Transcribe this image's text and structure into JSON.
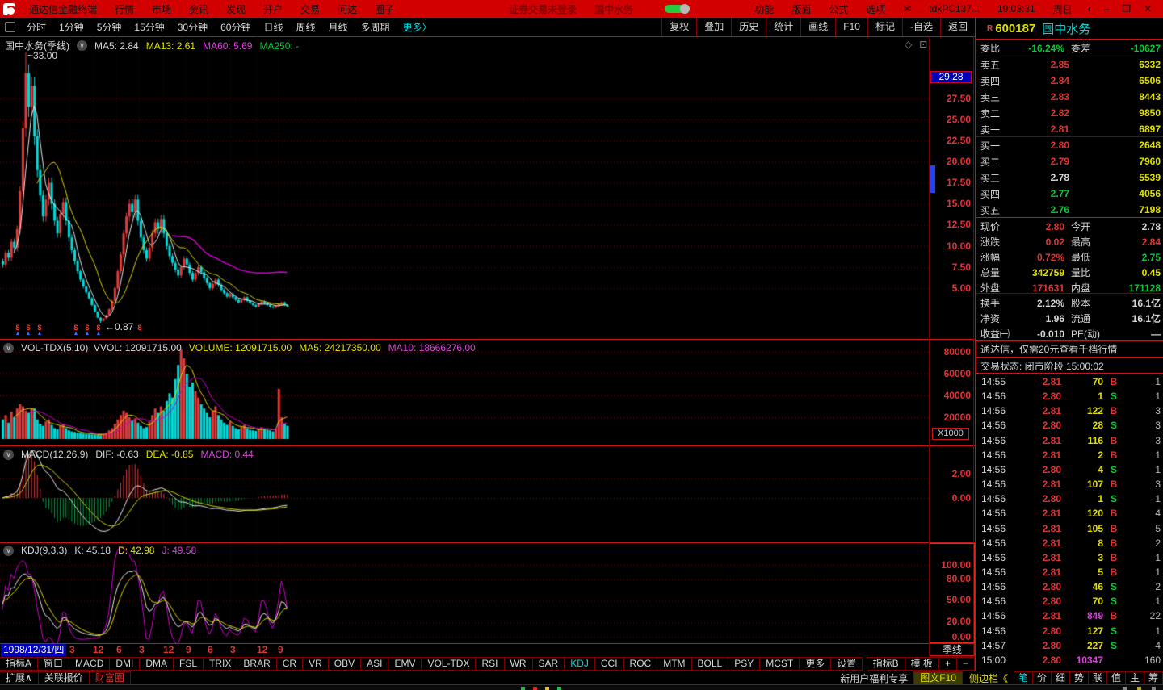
{
  "colors": {
    "red": "#e03333",
    "yellow": "#e0e000",
    "cyan": "#00d8d8",
    "green": "#00cc33",
    "magenta": "#d844d8",
    "white": "#d8d8d8",
    "blue": "#0000bb",
    "titlebar_red": "#d20000",
    "up_candle": "#e23b3b",
    "down_candle": "#00dcdc"
  },
  "titlebar": {
    "app_name": "通达信金融终端",
    "menus": [
      "行情",
      "市场",
      "资讯",
      "发现",
      "开户",
      "交易",
      "问达",
      "圈子"
    ],
    "login_status": "证券交易未登录",
    "current_stock": "国中水务",
    "right_menus": [
      "功能",
      "版面",
      "公式",
      "选项"
    ],
    "mail_icon": "✉",
    "host": "tdxPC137...",
    "clock": "19:03:31",
    "weekday": "周日",
    "window_controls": [
      "‹",
      "–",
      "❐",
      "✕"
    ]
  },
  "toolbar": {
    "periods": [
      "分时",
      "1分钟",
      "5分钟",
      "15分钟",
      "30分钟",
      "60分钟",
      "日线",
      "周线",
      "月线",
      "多周期"
    ],
    "more": "更多〉",
    "buttons": [
      "复权",
      "叠加",
      "历史",
      "统计",
      "画线",
      "F10",
      "标记",
      "-自选",
      "返回"
    ]
  },
  "chart": {
    "header": {
      "title": "国中水务(季线)",
      "ma5": "MA5: 2.84",
      "ma13": "MA13: 2.61",
      "ma60": "MA60: 5.69",
      "ma250": "MA250: -"
    },
    "corner_icons": [
      "◇",
      "⊡"
    ],
    "price_axis_labels": [
      "27.50",
      "25.00",
      "22.50",
      "20.00",
      "17.50",
      "15.00",
      "12.50",
      "10.00",
      "7.50",
      "5.00"
    ],
    "price_tag": "29.28",
    "peak_label": "~33.00",
    "trough_label": "←0.87",
    "vol_header": {
      "name": "VOL-TDX(5,10)",
      "vvol": "VVOL: 12091715.00",
      "volume": "VOLUME: 12091715.00",
      "ma5": "MA5: 24217350.00",
      "ma10": "MA10: 18666276.00"
    },
    "vol_axis_labels": [
      "80000",
      "60000",
      "40000",
      "20000"
    ],
    "vol_unit": "X1000",
    "macd_header": {
      "name": "MACD(12,26,9)",
      "dif": "DIF: -0.63",
      "dea": "DEA: -0.85",
      "macd": "MACD: 0.44"
    },
    "macd_axis_labels": [
      "2.00",
      "0.00"
    ],
    "kdj_header": {
      "name": "KDJ(9,3,3)",
      "k": "K: 45.18",
      "d": "D: 42.98",
      "j": "J: 49.58"
    },
    "kdj_axis_labels": [
      "100.00",
      "80.00",
      "50.00",
      "20.00",
      "0.00"
    ],
    "date_start": "1998/12/31/四",
    "date_ticks": [
      "3",
      "12",
      "6",
      "3",
      "12",
      "9",
      "6",
      "3",
      "12",
      "9"
    ],
    "period_label": "季线"
  },
  "chart_data": {
    "type": "candlestick",
    "closes": [
      7.8,
      9.2,
      8.6,
      10.5,
      9.8,
      12.0,
      16.5,
      24.0,
      30.5,
      26.5,
      29.0,
      23.0,
      19.0,
      16.0,
      13.5,
      15.5,
      17.5,
      15.0,
      13.0,
      11.5,
      13.8,
      15.2,
      13.0,
      11.0,
      9.5,
      8.2,
      7.0,
      6.0,
      5.2,
      4.5,
      3.8,
      3.0,
      2.2,
      1.5,
      1.1,
      1.4,
      1.8,
      2.5,
      3.5,
      5.0,
      7.0,
      9.0,
      11.5,
      13.5,
      15.0,
      14.0,
      15.5,
      13.0,
      11.0,
      9.5,
      8.5,
      9.8,
      11.5,
      12.8,
      12.0,
      13.2,
      11.5,
      10.0,
      8.8,
      8.0,
      7.2,
      6.5,
      7.5,
      8.5,
      7.8,
      6.8,
      6.0,
      6.8,
      7.5,
      6.9,
      6.2,
      5.6,
      5.0,
      5.5,
      6.0,
      5.4,
      4.8,
      4.4,
      4.0,
      4.3,
      3.9,
      3.6,
      3.3,
      3.6,
      3.9,
      3.5,
      3.2,
      3.0,
      2.8,
      3.1,
      3.4,
      3.2,
      3.0,
      2.8,
      2.7,
      2.9,
      3.1,
      3.3,
      3.0,
      2.8
    ],
    "volumes": [
      18000,
      22000,
      15000,
      25000,
      20000,
      28000,
      32000,
      30000,
      26000,
      24000,
      28000,
      28000,
      18000,
      14000,
      12000,
      16000,
      18000,
      13000,
      10000,
      9000,
      12000,
      14000,
      10000,
      8000,
      7000,
      6500,
      6000,
      5500,
      5000,
      4800,
      4500,
      4200,
      4000,
      3800,
      3500,
      5000,
      6000,
      8000,
      10000,
      14000,
      18000,
      22000,
      26000,
      24000,
      20000,
      17000,
      19000,
      15000,
      12000,
      10000,
      11000,
      16000,
      22000,
      28000,
      24000,
      30000,
      26000,
      35000,
      42000,
      38000,
      55000,
      68000,
      82000,
      74000,
      60000,
      48000,
      52000,
      44000,
      38000,
      32000,
      28000,
      24000,
      20000,
      26000,
      30000,
      22000,
      18000,
      15000,
      13000,
      16000,
      12000,
      10000,
      9000,
      11000,
      13000,
      10000,
      8500,
      8000,
      7500,
      9000,
      11000,
      9500,
      8500,
      8000,
      7000,
      9000,
      46000,
      20000,
      14000,
      12092
    ],
    "peak": {
      "index": 8,
      "high": 33.0
    },
    "trough": {
      "index": 34,
      "low": 0.87
    },
    "price_axis": {
      "min": 5.0,
      "max": 27.5,
      "step": 2.5
    },
    "volume_axis": {
      "max": 80000,
      "unit": "X1000"
    },
    "kdj_axis": [
      100,
      80,
      50,
      20,
      0
    ],
    "macd_axis": [
      2.0,
      0.0
    ]
  },
  "quote": {
    "flag": "R",
    "code": "600187",
    "name": "国中水务",
    "weibi_label": "委比",
    "weibi": "-16.24%",
    "weicha_label": "委差",
    "weicha": "-10627",
    "asks": [
      [
        "卖五",
        "2.85",
        "6332",
        "r"
      ],
      [
        "卖四",
        "2.84",
        "6506",
        "r"
      ],
      [
        "卖三",
        "2.83",
        "8443",
        "r"
      ],
      [
        "卖二",
        "2.82",
        "9850",
        "r"
      ],
      [
        "卖一",
        "2.81",
        "6897",
        "r"
      ]
    ],
    "bids": [
      [
        "买一",
        "2.80",
        "2648",
        "r"
      ],
      [
        "买二",
        "2.79",
        "7960",
        "r"
      ],
      [
        "买三",
        "2.78",
        "5539",
        "w"
      ],
      [
        "买四",
        "2.77",
        "4056",
        "g"
      ],
      [
        "买五",
        "2.76",
        "7198",
        "g"
      ]
    ],
    "stats": [
      [
        "现价",
        "2.80",
        "r",
        "今开",
        "2.78",
        "w"
      ],
      [
        "涨跌",
        "0.02",
        "r",
        "最高",
        "2.84",
        "r"
      ],
      [
        "涨幅",
        "0.72%",
        "r",
        "最低",
        "2.75",
        "g"
      ],
      [
        "总量",
        "342759",
        "y",
        "量比",
        "0.45",
        "y"
      ],
      [
        "外盘",
        "171631",
        "r",
        "内盘",
        "171128",
        "g"
      ],
      [
        "换手",
        "2.12%",
        "w",
        "股本",
        "16.1亿",
        "w"
      ],
      [
        "净资",
        "1.96",
        "w",
        "流通",
        "16.1亿",
        "w"
      ],
      [
        "收益㈠",
        "-0.010",
        "w",
        "PE(动)",
        "—",
        "w"
      ]
    ],
    "banner": "通达信，仅需20元查看千档行情",
    "session": "交易状态: 闭市阶段 15:00:02",
    "ticks": [
      [
        "14:55",
        "2.81",
        "70",
        "B",
        "1",
        "y"
      ],
      [
        "14:56",
        "2.80",
        "1",
        "S",
        "1",
        "y"
      ],
      [
        "14:56",
        "2.81",
        "122",
        "B",
        "3",
        "y"
      ],
      [
        "14:56",
        "2.80",
        "28",
        "S",
        "3",
        "y"
      ],
      [
        "14:56",
        "2.81",
        "116",
        "B",
        "3",
        "y"
      ],
      [
        "14:56",
        "2.81",
        "2",
        "B",
        "1",
        "y"
      ],
      [
        "14:56",
        "2.80",
        "4",
        "S",
        "1",
        "y"
      ],
      [
        "14:56",
        "2.81",
        "107",
        "B",
        "3",
        "y"
      ],
      [
        "14:56",
        "2.80",
        "1",
        "S",
        "1",
        "y"
      ],
      [
        "14:56",
        "2.81",
        "120",
        "B",
        "4",
        "y"
      ],
      [
        "14:56",
        "2.81",
        "105",
        "B",
        "5",
        "y"
      ],
      [
        "14:56",
        "2.81",
        "8",
        "B",
        "2",
        "y"
      ],
      [
        "14:56",
        "2.81",
        "3",
        "B",
        "1",
        "y"
      ],
      [
        "14:56",
        "2.81",
        "5",
        "B",
        "1",
        "y"
      ],
      [
        "14:56",
        "2.80",
        "46",
        "S",
        "2",
        "y"
      ],
      [
        "14:56",
        "2.80",
        "70",
        "S",
        "1",
        "y"
      ],
      [
        "14:56",
        "2.81",
        "849",
        "B",
        "22",
        "m"
      ],
      [
        "14:56",
        "2.80",
        "127",
        "S",
        "1",
        "y"
      ],
      [
        "14:57",
        "2.80",
        "227",
        "S",
        "4",
        "y"
      ],
      [
        "15:00",
        "2.80",
        "10347",
        "",
        "160",
        "m"
      ]
    ]
  },
  "tabs": {
    "left": [
      "指标A",
      "窗口",
      "MACD",
      "DMI",
      "DMA",
      "FSL",
      "TRIX",
      "BRAR",
      "CR",
      "VR",
      "OBV",
      "ASI",
      "EMV",
      "VOL-TDX",
      "RSI",
      "WR",
      "SAR",
      "KDJ",
      "CCI",
      "ROC",
      "MTM",
      "BOLL",
      "PSY",
      "MCST",
      "更多",
      "设置"
    ],
    "active": "KDJ",
    "right": [
      "指标B",
      "模 板",
      "+",
      "−"
    ]
  },
  "statusbar": {
    "left": [
      [
        "扩展∧",
        "w"
      ],
      [
        "关联报价",
        "w"
      ],
      [
        "财富圈",
        "r"
      ]
    ],
    "promo": "新用户福利专享",
    "f10": "图文F10",
    "sidebar": "侧边栏《",
    "right_tabs": [
      "笔",
      "价",
      "细",
      "势",
      "联",
      "值",
      "主",
      "筹"
    ],
    "active_tab": "笔"
  }
}
